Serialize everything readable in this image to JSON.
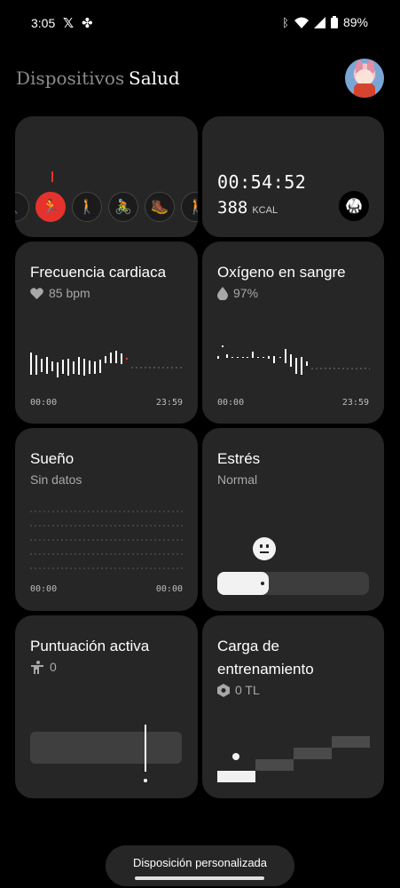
{
  "status_bar": {
    "time": "3:05",
    "battery": "89%",
    "icons": [
      "x-app-icon",
      "pinwheel-app-icon",
      "bluetooth-icon",
      "wifi-icon",
      "signal-icon",
      "battery-icon"
    ]
  },
  "header": {
    "tabs": [
      {
        "label": "Dispositivos",
        "active": false
      },
      {
        "label": "Salud",
        "active": true
      }
    ]
  },
  "cards": {
    "activity": {
      "icons": [
        "hiking-icon",
        "running-icon",
        "walking-icon",
        "cycling-icon",
        "hiking-stick-icon",
        "walking-icon"
      ],
      "active_index": 1
    },
    "workout": {
      "duration": "00:54:52",
      "kcal_value": "388",
      "kcal_unit": "KCAL"
    },
    "heart_rate": {
      "title": "Frecuencia cardiaca",
      "value": "85 bpm",
      "start": "00:00",
      "end": "23:59"
    },
    "blood_oxygen": {
      "title": "Oxígeno en sangre",
      "value": "97%",
      "start": "00:00",
      "end": "23:59"
    },
    "sleep": {
      "title": "Sueño",
      "value": "Sin datos",
      "start": "00:00",
      "end": "00:00"
    },
    "stress": {
      "title": "Estrés",
      "value": "Normal",
      "level": 0.34
    },
    "active_score": {
      "title": "Puntuación activa",
      "value": "0"
    },
    "training_load": {
      "title": "Carga de entrenamiento",
      "value": "0 TL"
    }
  },
  "bottom_button": {
    "label": "Disposición personalizada"
  },
  "colors": {
    "background": "#000000",
    "card": "#262626",
    "accent": "#e5322d",
    "muted_text": "#a8a8a8"
  }
}
